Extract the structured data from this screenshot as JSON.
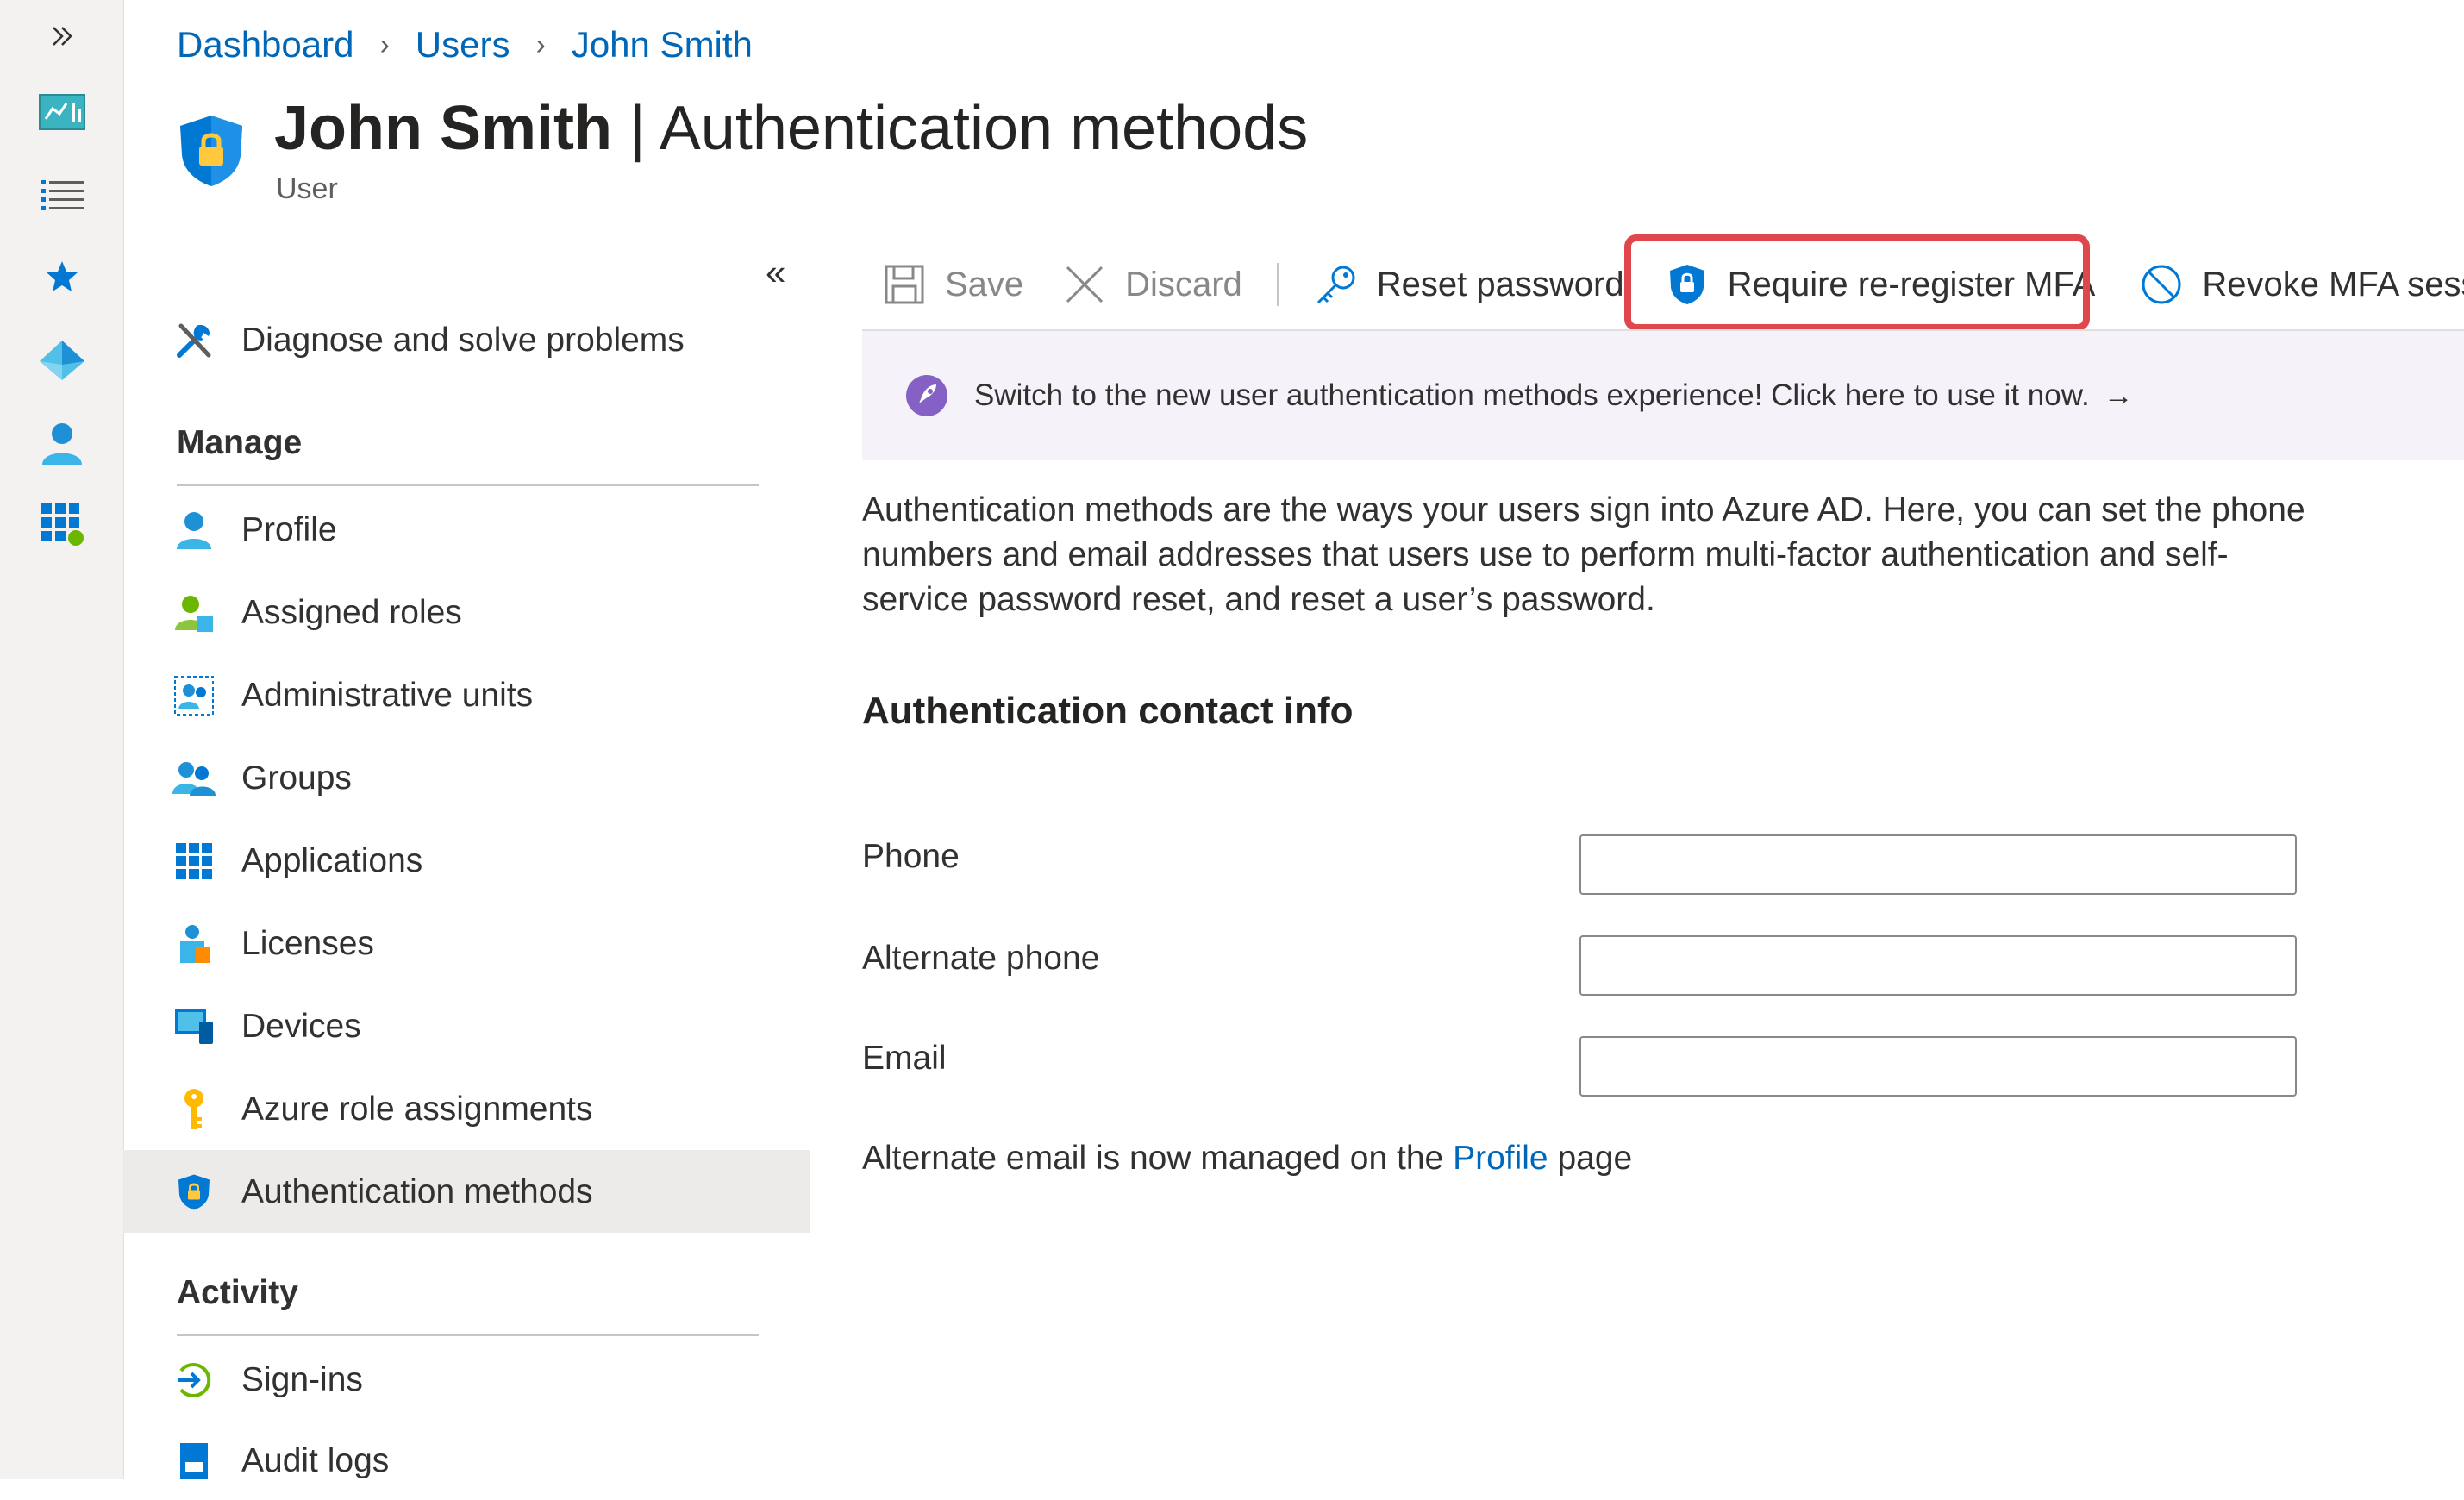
{
  "breadcrumb": {
    "items": [
      "Dashboard",
      "Users",
      "John Smith"
    ]
  },
  "header": {
    "title_bold": "John Smith",
    "title_sep": " | ",
    "title_rest": "Authentication methods",
    "subtitle": "User"
  },
  "rail": {
    "icons": [
      "expand-icon",
      "dashboard-icon",
      "all-services-icon",
      "favorites-icon",
      "azure-ad-icon",
      "users-icon",
      "apps-icon"
    ]
  },
  "nav": {
    "diagnose": "Diagnose and solve problems",
    "manage_header": "Manage",
    "manage_items": [
      "Profile",
      "Assigned roles",
      "Administrative units",
      "Groups",
      "Applications",
      "Licenses",
      "Devices",
      "Azure role assignments",
      "Authentication methods"
    ],
    "active": "Authentication methods",
    "activity_header": "Activity",
    "activity_items": [
      "Sign-ins",
      "Audit logs"
    ]
  },
  "toolbar": {
    "save": "Save",
    "discard": "Discard",
    "reset_password": "Reset password",
    "require_mfa": "Require re-register MFA",
    "revoke_mfa": "Revoke MFA session"
  },
  "banner": {
    "text": "Switch to the new user authentication methods experience! Click here to use it now.",
    "arrow": "→"
  },
  "description": "Authentication methods are the ways your users sign into Azure AD. Here, you can set the phone numbers and email addresses that users use to perform multi-factor authentication and self-service password reset, and reset a user’s password.",
  "contact": {
    "heading": "Authentication contact info",
    "phone_label": "Phone",
    "phone_value": "",
    "alt_phone_label": "Alternate phone",
    "alt_phone_value": "",
    "email_label": "Email",
    "email_value": ""
  },
  "note": {
    "prefix": "Alternate email is now managed on the ",
    "link": "Profile",
    "suffix": " page"
  },
  "colors": {
    "accent": "#0067b8",
    "highlight": "#e0474c",
    "banner_bg": "#f5f2fa",
    "active_nav": "#edebe9"
  }
}
